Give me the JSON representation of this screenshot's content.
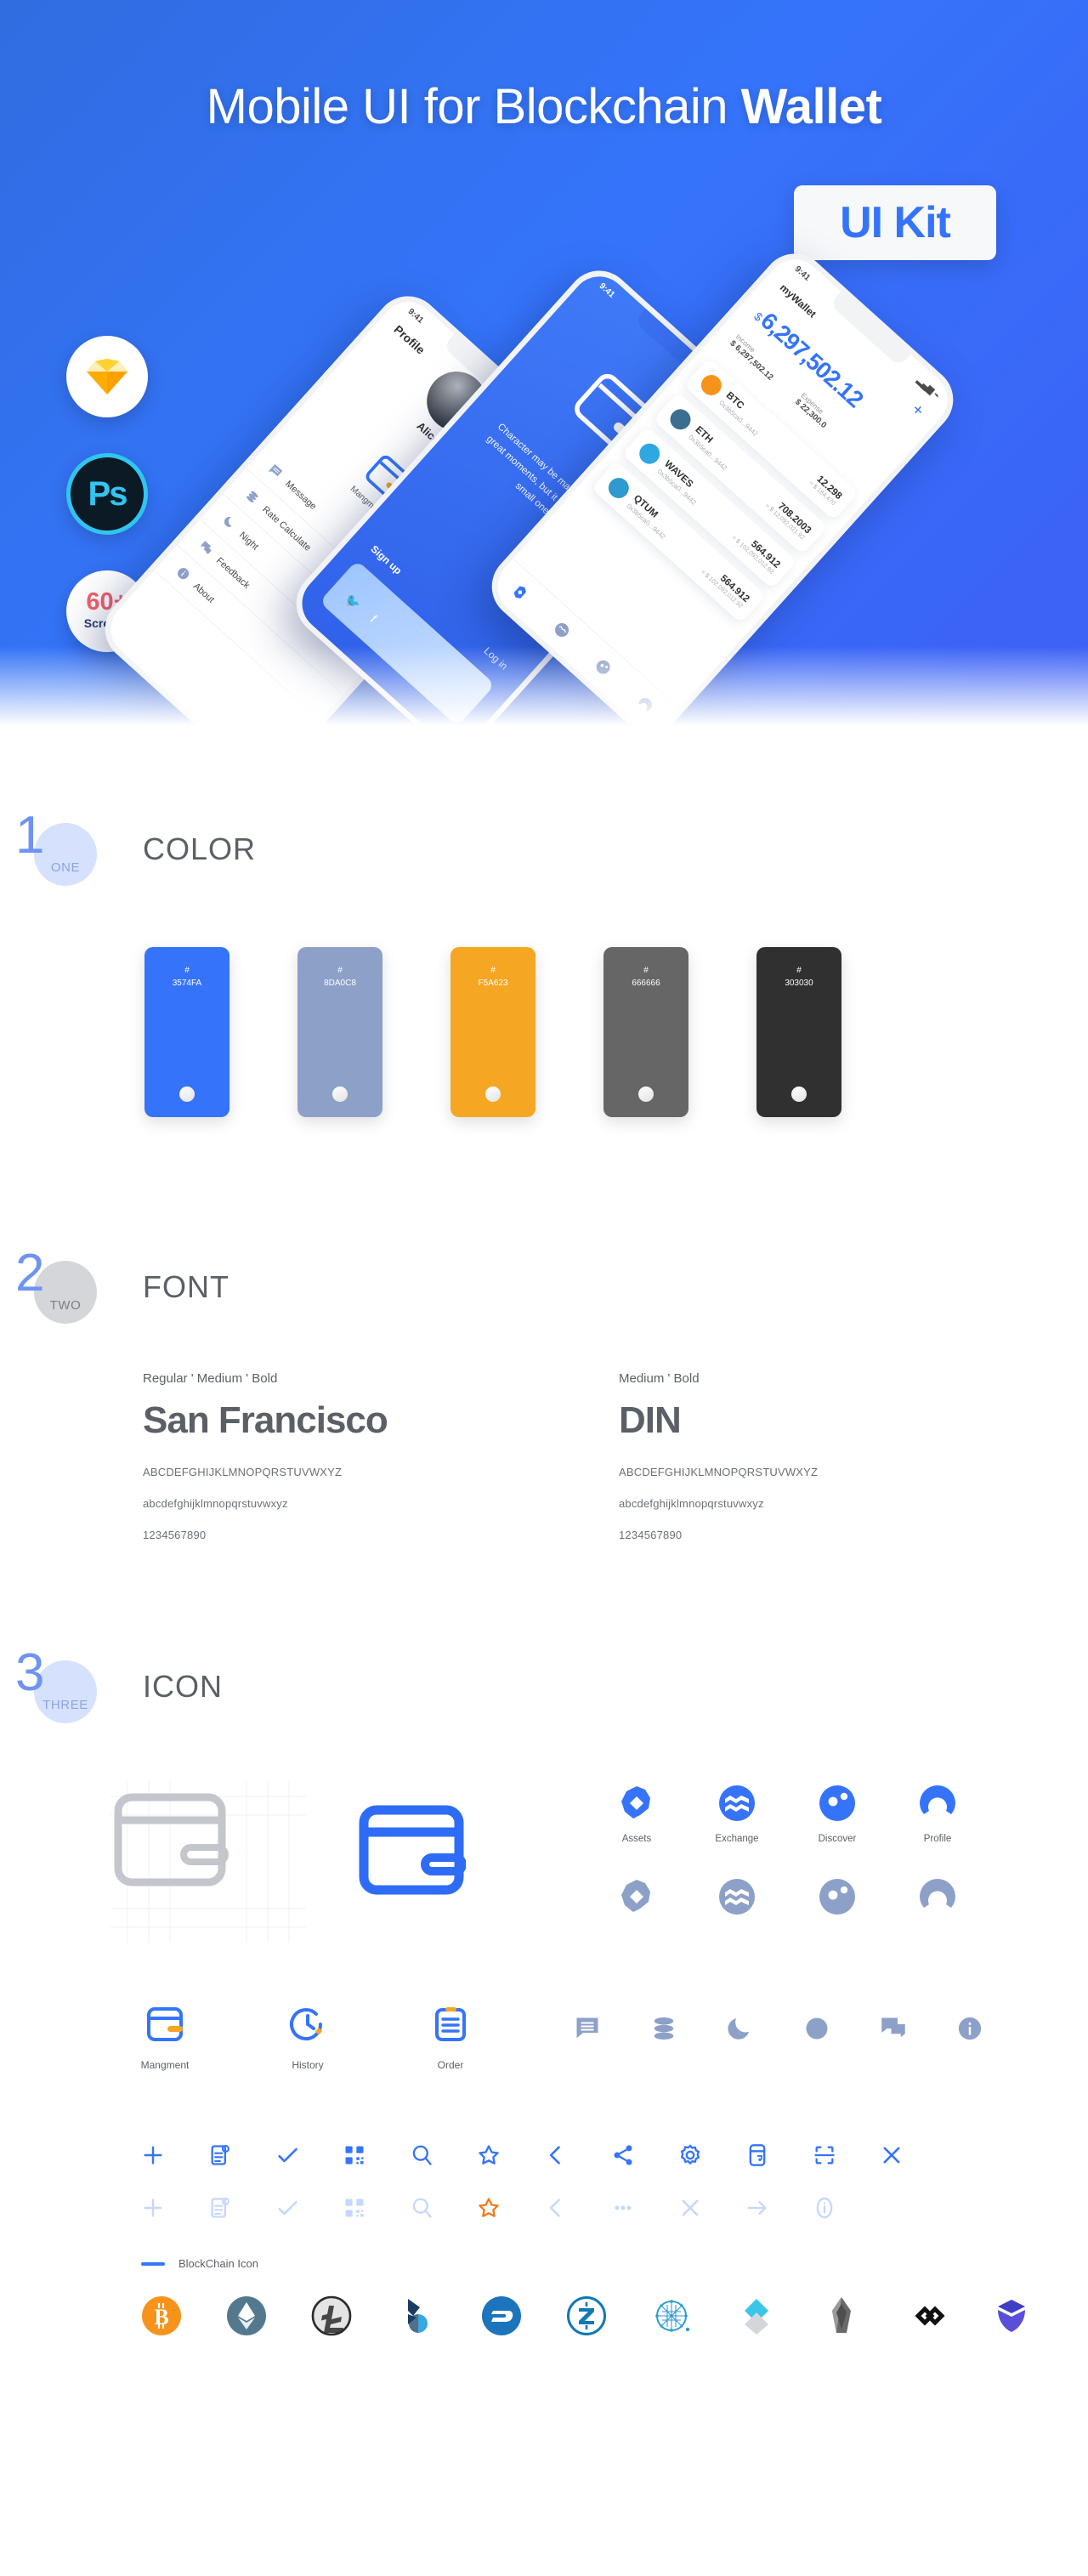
{
  "hero": {
    "title_regular": "Mobile UI for Blockchain ",
    "title_bold": "Wallet",
    "uikit_badge": "UI Kit",
    "badges": [
      {
        "name": "sketch",
        "label": "Sketch"
      },
      {
        "name": "photoshop",
        "label": "Ps"
      },
      {
        "name": "screens",
        "number": "60+",
        "caption": "Screens"
      }
    ],
    "phone_profile": {
      "time": "9:41",
      "title": "Profile",
      "user_name": "Alice",
      "management_label": "Mangment",
      "rows": [
        {
          "icon": "message-icon",
          "label": "Message"
        },
        {
          "icon": "rate-calculator-icon",
          "label": "Rate Calculate"
        },
        {
          "icon": "night-icon",
          "label": "Night"
        },
        {
          "icon": "feedback-icon",
          "label": "Feedback"
        },
        {
          "icon": "about-icon",
          "label": "About"
        }
      ]
    },
    "phone_signup": {
      "time": "9:41",
      "body": "Character may be manifested in the great moments, but it is made in the small ones.",
      "signup": "Sign up",
      "login": "Log in"
    },
    "phone_wallet": {
      "time": "9:41",
      "title": "myWallet",
      "currency": "$",
      "balance": "6,297,502.12",
      "income_label": "Income",
      "income_value": "$ 6,297,502.12",
      "expense_label": "Expense",
      "expense_value": "$ 22,300.0",
      "coins": [
        {
          "symbol": "BTC",
          "address": "0x3b5ca0...9442",
          "amount": "12.298",
          "usd": "≈ $ 184,470",
          "color": "#f7931a"
        },
        {
          "symbol": "ETH",
          "address": "0x3b5ca0...9442",
          "amount": "708.2003",
          "usd": "≈ $ 12,092,021.92",
          "color": "#3c6e8f"
        },
        {
          "symbol": "WAVES",
          "address": "0x3b5ca0...9442",
          "amount": "564.912",
          "usd": "≈ $ 102,092,012.92",
          "color": "#2fa7e0"
        },
        {
          "symbol": "QTUM",
          "address": "0x3b5ca0...9442",
          "amount": "564.912",
          "usd": "≈ $ 102,092,012.92",
          "color": "#2e9ad0"
        }
      ],
      "tabs": [
        "Assets",
        "Exchange",
        "Discover",
        "Profile"
      ]
    }
  },
  "color_section": {
    "number": "1",
    "word": "ONE",
    "title": "COLOR",
    "swatches": [
      {
        "hash": "#",
        "hex": "3574FA",
        "value": "#3574FA"
      },
      {
        "hash": "#",
        "hex": "8DA0C8",
        "value": "#8DA0C8"
      },
      {
        "hash": "#",
        "hex": "F5A623",
        "value": "#F5A623"
      },
      {
        "hash": "#",
        "hex": "666666",
        "value": "#666666"
      },
      {
        "hash": "#",
        "hex": "303030",
        "value": "#303030"
      }
    ]
  },
  "font_section": {
    "number": "2",
    "word": "TWO",
    "title": "FONT",
    "columns": [
      {
        "weights": "Regular ' Medium ' Bold",
        "name": "San Francisco",
        "uppercase": "ABCDEFGHIJKLMNOPQRSTUVWXYZ",
        "lowercase": "abcdefghijklmnopqrstuvwxyz",
        "digits": "1234567890"
      },
      {
        "weights": "Medium ' Bold",
        "name": "DIN",
        "uppercase": "ABCDEFGHIJKLMNOPQRSTUVWXYZ",
        "lowercase": "abcdefghijklmnopqrstuvwxyz",
        "digits": "1234567890"
      }
    ]
  },
  "icon_section": {
    "number": "3",
    "word": "THREE",
    "title": "ICON",
    "tab_icons": [
      {
        "name": "assets-icon",
        "label": "Assets"
      },
      {
        "name": "exchange-icon",
        "label": "Exchange"
      },
      {
        "name": "discover-icon",
        "label": "Discover"
      },
      {
        "name": "profile-icon",
        "label": "Profile"
      }
    ],
    "function_icons": [
      {
        "name": "management-icon",
        "label": "Mangment"
      },
      {
        "name": "history-icon",
        "label": "History"
      },
      {
        "name": "order-icon",
        "label": "Order"
      }
    ],
    "flat_icons": [
      "message-icon",
      "database-icon",
      "moon-icon",
      "circle-icon",
      "chat-icon",
      "info-icon"
    ],
    "line_icons": [
      "plus-icon",
      "doc-settings-icon",
      "check-icon",
      "qr-icon",
      "search-icon",
      "star-icon",
      "chevron-left-icon",
      "share-icon",
      "gear-icon",
      "card-icon",
      "scan-icon",
      "close-icon"
    ],
    "line_icons_muted": [
      "plus-icon",
      "doc-settings-icon",
      "check-icon",
      "qr-icon",
      "search-icon",
      "star-icon",
      "chevron-left-icon",
      "more-icon",
      "close-icon",
      "arrow-right-icon",
      "info-outline-icon"
    ],
    "blockchain_label": "BlockChain Icon",
    "coins": [
      {
        "name": "bitcoin-icon",
        "symbol": "BTC",
        "color": "#f7931a"
      },
      {
        "name": "ethereum-icon",
        "symbol": "ETH",
        "color": "#54798f"
      },
      {
        "name": "litecoin-icon",
        "symbol": "LTC",
        "color": "#bfbfbf"
      },
      {
        "name": "bitshares-icon",
        "symbol": "BTS",
        "color": "#1b3d63"
      },
      {
        "name": "dash-icon",
        "symbol": "DASH",
        "color": "#1c75bc"
      },
      {
        "name": "zcash-icon",
        "symbol": "ZEC",
        "color": "#1079b5"
      },
      {
        "name": "qtum-icon",
        "symbol": "QTUM",
        "color": "#2e9ad0"
      },
      {
        "name": "waves-icon",
        "symbol": "WAVES",
        "color": "#3bc6e8"
      },
      {
        "name": "eos-icon",
        "symbol": "EOS",
        "color": "#6a6a6a"
      },
      {
        "name": "loopring-icon",
        "symbol": "LRC",
        "color": "#111111"
      },
      {
        "name": "neo-icon",
        "symbol": "NEO",
        "color": "#3f3fc4"
      }
    ]
  }
}
